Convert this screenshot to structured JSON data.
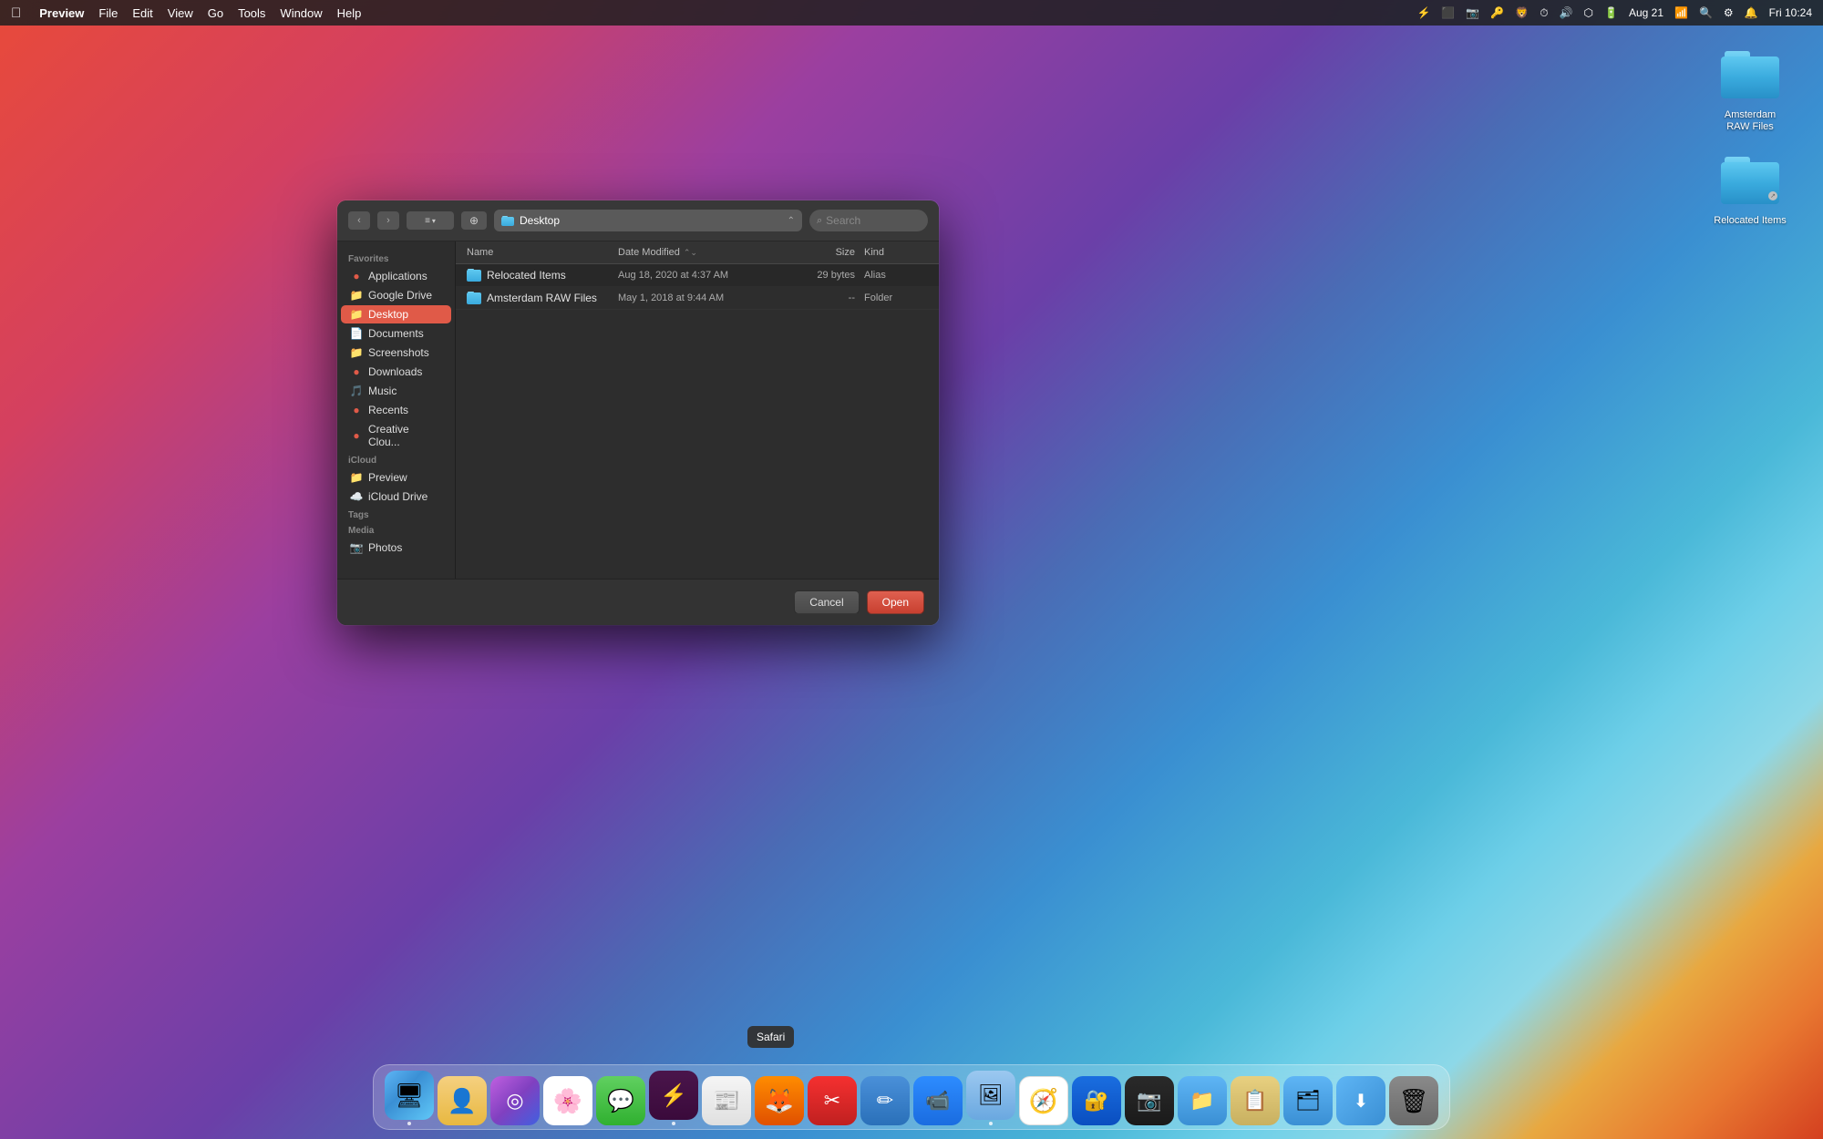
{
  "menubar": {
    "apple": "⌘",
    "app_name": "Preview",
    "menu_items": [
      "File",
      "Edit",
      "View",
      "Go",
      "Tools",
      "Window",
      "Help"
    ],
    "right_items": [
      "Aug 21",
      "Fri 10:24"
    ]
  },
  "desktop": {
    "icons": [
      {
        "id": "amsterdam-raw",
        "label": "Amsterdam RAW Files"
      },
      {
        "id": "relocated-items",
        "label": "Relocated Items"
      }
    ]
  },
  "dialog": {
    "toolbar": {
      "location": "Desktop",
      "search_placeholder": "Search"
    },
    "sidebar": {
      "sections": [
        {
          "label": "Favorites",
          "items": [
            {
              "id": "applications",
              "label": "Applications",
              "icon": "🔴"
            },
            {
              "id": "google-drive",
              "label": "Google Drive",
              "icon": "📁"
            },
            {
              "id": "desktop",
              "label": "Desktop",
              "icon": "📁",
              "active": true
            },
            {
              "id": "documents",
              "label": "Documents",
              "icon": "📄"
            },
            {
              "id": "screenshots",
              "label": "Screenshots",
              "icon": "📁"
            },
            {
              "id": "downloads",
              "label": "Downloads",
              "icon": "🔴"
            },
            {
              "id": "music",
              "label": "Music",
              "icon": "🎵"
            },
            {
              "id": "recents",
              "label": "Recents",
              "icon": "🔴"
            },
            {
              "id": "creative-cloud",
              "label": "Creative Clou...",
              "icon": "🔴"
            }
          ]
        },
        {
          "label": "iCloud",
          "items": [
            {
              "id": "preview",
              "label": "Preview",
              "icon": "📁"
            },
            {
              "id": "icloud-drive",
              "label": "iCloud Drive",
              "icon": "☁️"
            }
          ]
        },
        {
          "label": "Tags",
          "items": []
        },
        {
          "label": "Media",
          "items": [
            {
              "id": "photos",
              "label": "Photos",
              "icon": "📷"
            }
          ]
        }
      ]
    },
    "file_list": {
      "columns": {
        "name": "Name",
        "date_modified": "Date Modified",
        "size": "Size",
        "kind": "Kind"
      },
      "files": [
        {
          "name": "Relocated Items",
          "date": "Aug 18, 2020 at 4:37 AM",
          "size": "29 bytes",
          "kind": "Alias"
        },
        {
          "name": "Amsterdam RAW Files",
          "date": "May 1, 2018 at 9:44 AM",
          "size": "--",
          "kind": "Folder"
        }
      ]
    },
    "footer": {
      "cancel_label": "Cancel",
      "open_label": "Open"
    }
  },
  "dock": {
    "apps": [
      {
        "id": "finder",
        "label": "Finder",
        "color_class": "finder-app",
        "symbol": "🔵",
        "has_dot": true
      },
      {
        "id": "contacts",
        "label": "Contacts",
        "color_class": "contacts-app",
        "symbol": "👤",
        "has_dot": false
      },
      {
        "id": "siri",
        "label": "Siri",
        "color_class": "siri-app",
        "symbol": "🎙",
        "has_dot": false
      },
      {
        "id": "photos",
        "label": "Photos",
        "color_class": "photos-app",
        "symbol": "🌸",
        "has_dot": false
      },
      {
        "id": "messages",
        "label": "Messages",
        "color_class": "messages-app",
        "symbol": "💬",
        "has_dot": false
      },
      {
        "id": "slack",
        "label": "Slack",
        "color_class": "slack-app",
        "symbol": "💬",
        "has_dot": true
      },
      {
        "id": "news",
        "label": "News",
        "color_class": "news-app",
        "symbol": "📰",
        "has_dot": false
      },
      {
        "id": "firefox",
        "label": "Firefox",
        "color_class": "firefox-app",
        "symbol": "🦊",
        "has_dot": false
      },
      {
        "id": "pockity",
        "label": "Pockity",
        "color_class": "pockity-app",
        "symbol": "✂",
        "has_dot": false
      },
      {
        "id": "taffy",
        "label": "Taffy",
        "color_class": "taffy-app",
        "symbol": "✏",
        "has_dot": false
      },
      {
        "id": "zoom",
        "label": "Zoom",
        "color_class": "zoom-app",
        "symbol": "📹",
        "has_dot": false
      },
      {
        "id": "preview",
        "label": "Preview",
        "color_class": "preview-app",
        "symbol": "🖼",
        "has_dot": true
      },
      {
        "id": "safari",
        "label": "Safari",
        "color_class": "safari-app",
        "symbol": "🧭",
        "has_dot": false
      },
      {
        "id": "onepassword",
        "label": "1Password",
        "color_class": "onepassword-app",
        "symbol": "🔐",
        "has_dot": false
      },
      {
        "id": "darkroom",
        "label": "Darkroom",
        "color_class": "darkroom-app",
        "symbol": "📷",
        "has_dot": false
      },
      {
        "id": "files",
        "label": "Files",
        "color_class": "files-app",
        "symbol": "📁",
        "has_dot": false
      },
      {
        "id": "filemanager",
        "label": "File Manager",
        "color_class": "filemanager-app",
        "symbol": "📋",
        "has_dot": false
      },
      {
        "id": "browsefolder",
        "label": "Browse Folder",
        "color_class": "browsefolder-app",
        "symbol": "🗂",
        "has_dot": false
      },
      {
        "id": "downloads",
        "label": "Downloads",
        "color_class": "downloads-app",
        "symbol": "⬇",
        "has_dot": false
      },
      {
        "id": "trash",
        "label": "Trash",
        "color_class": "trash-app",
        "symbol": "🗑",
        "has_dot": false
      }
    ],
    "safari_tooltip": "Safari"
  }
}
